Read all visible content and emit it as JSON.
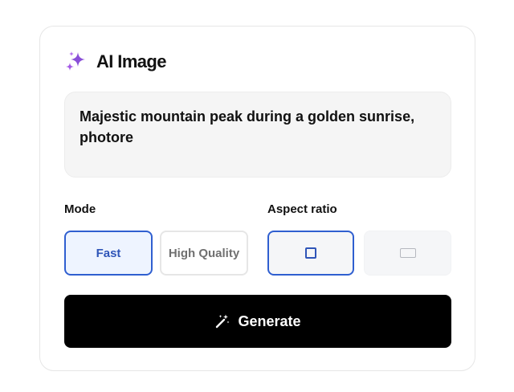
{
  "header": {
    "title": "AI Image",
    "icon": "sparkles-icon",
    "icon_color": "#8a4fd8"
  },
  "prompt": {
    "value": "Majestic mountain peak during a golden sunrise, photore"
  },
  "mode": {
    "label": "Mode",
    "options": [
      {
        "label": "Fast",
        "selected": true
      },
      {
        "label": "High Quality",
        "selected": false
      }
    ]
  },
  "aspect_ratio": {
    "label": "Aspect ratio",
    "options": [
      {
        "icon": "square-ratio-icon",
        "selected": true
      },
      {
        "icon": "wide-ratio-icon",
        "selected": false
      }
    ]
  },
  "generate": {
    "label": "Generate",
    "icon": "magic-wand-icon"
  },
  "colors": {
    "accent": "#2f5fd0",
    "selected_bg": "#eef4ff",
    "button_bg": "#000000"
  }
}
